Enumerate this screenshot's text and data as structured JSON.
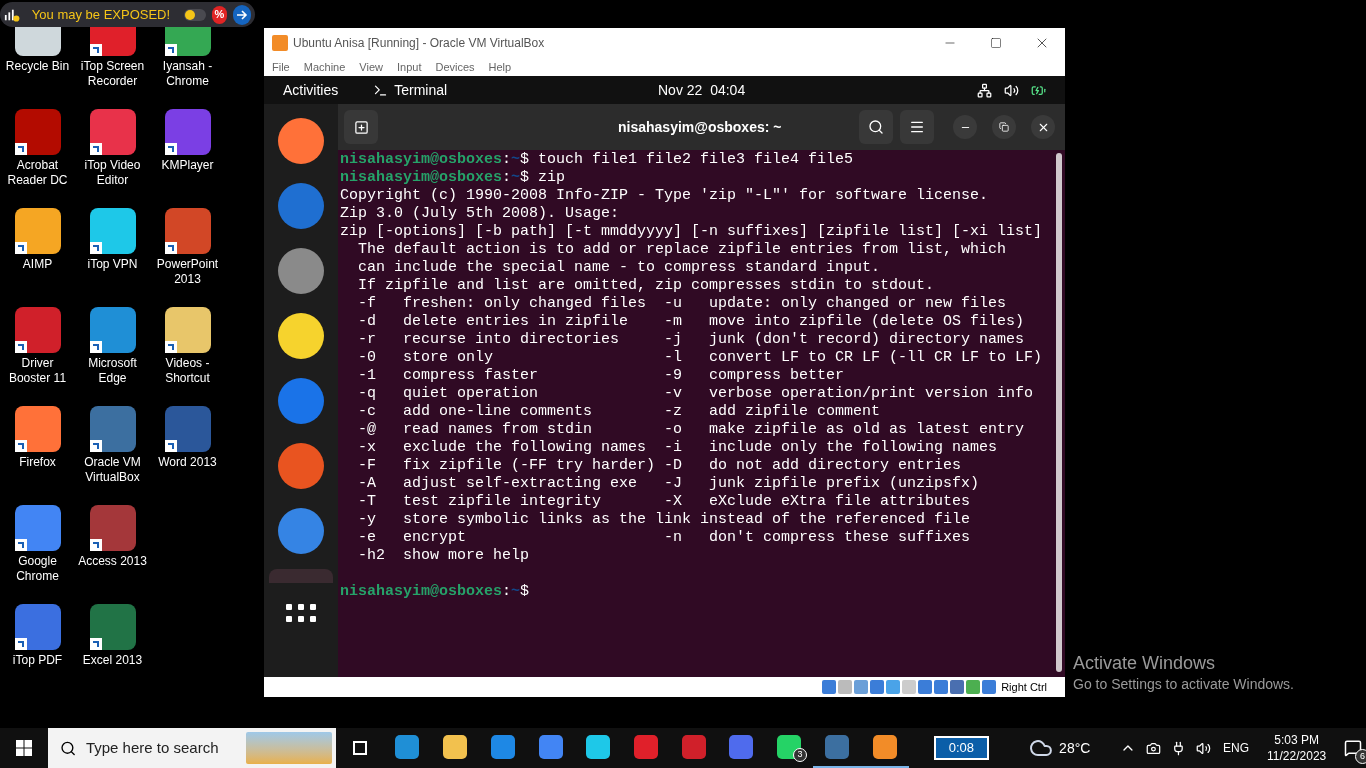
{
  "banner": {
    "text": "You may be EXPOSED!",
    "toggle_on": false,
    "badge": "%"
  },
  "desktop_icons": [
    {
      "label": "Recycle Bin",
      "color": "#cfd8dc",
      "shortcut": false
    },
    {
      "label": "Acrobat Reader DC",
      "color": "#b30b00",
      "shortcut": true
    },
    {
      "label": "AIMP",
      "color": "#f5a623",
      "shortcut": true
    },
    {
      "label": "Driver Booster 11",
      "color": "#d0202a",
      "shortcut": true
    },
    {
      "label": "Firefox",
      "color": "#ff7139",
      "shortcut": true
    },
    {
      "label": "Google Chrome",
      "color": "#4285f4",
      "shortcut": true
    },
    {
      "label": "iTop PDF",
      "color": "#3b6fe0",
      "shortcut": true
    },
    {
      "label": "iTop Screen Recorder",
      "color": "#e0202a",
      "shortcut": true
    },
    {
      "label": "iTop Video Editor",
      "color": "#e8324a",
      "shortcut": true
    },
    {
      "label": "iTop VPN",
      "color": "#1ec8e8",
      "shortcut": true
    },
    {
      "label": "Microsoft Edge",
      "color": "#1f8fd6",
      "shortcut": true
    },
    {
      "label": "Oracle VM VirtualBox",
      "color": "#3c6fa0",
      "shortcut": true
    },
    {
      "label": "Access 2013",
      "color": "#a4373a",
      "shortcut": true
    },
    {
      "label": "Excel 2013",
      "color": "#217346",
      "shortcut": true
    },
    {
      "label": "Iyansah - Chrome",
      "color": "#34a853",
      "shortcut": true
    },
    {
      "label": "KMPlayer",
      "color": "#7b3fe4",
      "shortcut": true
    },
    {
      "label": "PowerPoint 2013",
      "color": "#d24726",
      "shortcut": true
    },
    {
      "label": "Videos - Shortcut",
      "color": "#e8c66a",
      "shortcut": true
    },
    {
      "label": "Word 2013",
      "color": "#2b579a",
      "shortcut": true
    }
  ],
  "vm_window": {
    "title": "Ubuntu Anisa [Running] - Oracle VM VirtualBox",
    "menu": [
      "File",
      "Machine",
      "View",
      "Input",
      "Devices",
      "Help"
    ],
    "status_key": "Right Ctrl"
  },
  "ubuntu": {
    "activities": "Activities",
    "app_name": "Terminal",
    "clock": "Nov 22  04:04"
  },
  "terminal": {
    "title": "nisahasyim@osboxes: ~",
    "lines": [
      {
        "kind": "prompt",
        "user": "nisahasyim@osboxes",
        "colon": ":",
        "path": "~",
        "command": "$ touch file1 file2 file3 file4 file5"
      },
      {
        "kind": "prompt",
        "user": "nisahasyim@osboxes",
        "colon": ":",
        "path": "~",
        "command": "$ zip"
      },
      {
        "kind": "output",
        "text": "Copyright (c) 1990-2008 Info-ZIP - Type 'zip \"-L\"' for software license."
      },
      {
        "kind": "output",
        "text": "Zip 3.0 (July 5th 2008). Usage:"
      },
      {
        "kind": "output",
        "text": "zip [-options] [-b path] [-t mmddyyyy] [-n suffixes] [zipfile list] [-xi list]"
      },
      {
        "kind": "output",
        "text": "  The default action is to add or replace zipfile entries from list, which"
      },
      {
        "kind": "output",
        "text": "  can include the special name - to compress standard input."
      },
      {
        "kind": "output",
        "text": "  If zipfile and list are omitted, zip compresses stdin to stdout."
      },
      {
        "kind": "output",
        "text": "  -f   freshen: only changed files  -u   update: only changed or new files"
      },
      {
        "kind": "output",
        "text": "  -d   delete entries in zipfile    -m   move into zipfile (delete OS files)"
      },
      {
        "kind": "output",
        "text": "  -r   recurse into directories     -j   junk (don't record) directory names"
      },
      {
        "kind": "output",
        "text": "  -0   store only                   -l   convert LF to CR LF (-ll CR LF to LF)"
      },
      {
        "kind": "output",
        "text": "  -1   compress faster              -9   compress better"
      },
      {
        "kind": "output",
        "text": "  -q   quiet operation              -v   verbose operation/print version info"
      },
      {
        "kind": "output",
        "text": "  -c   add one-line comments        -z   add zipfile comment"
      },
      {
        "kind": "output",
        "text": "  -@   read names from stdin        -o   make zipfile as old as latest entry"
      },
      {
        "kind": "output",
        "text": "  -x   exclude the following names  -i   include only the following names"
      },
      {
        "kind": "output",
        "text": "  -F   fix zipfile (-FF try harder) -D   do not add directory entries"
      },
      {
        "kind": "output",
        "text": "  -A   adjust self-extracting exe   -J   junk zipfile prefix (unzipsfx)"
      },
      {
        "kind": "output",
        "text": "  -T   test zipfile integrity       -X   eXclude eXtra file attributes"
      },
      {
        "kind": "output",
        "text": "  -y   store symbolic links as the link instead of the referenced file"
      },
      {
        "kind": "output",
        "text": "  -e   encrypt                      -n   don't compress these suffixes"
      },
      {
        "kind": "output",
        "text": "  -h2  show more help"
      },
      {
        "kind": "blank"
      },
      {
        "kind": "prompt",
        "user": "nisahasyim@osboxes",
        "colon": ":",
        "path": "~",
        "command": "$"
      }
    ]
  },
  "activation": {
    "title": "Activate Windows",
    "subtitle": "Go to Settings to activate Windows."
  },
  "taskbar": {
    "search_placeholder": "Type here to search",
    "apps": [
      {
        "color": "#1f8fd6",
        "running": false
      },
      {
        "color": "#f2c14e",
        "running": false
      },
      {
        "color": "#1e88e5",
        "running": false
      },
      {
        "color": "#4285f4",
        "running": false
      },
      {
        "color": "#1ec8e8",
        "running": false
      },
      {
        "color": "#e0202a",
        "running": false
      },
      {
        "color": "#d0202a",
        "running": false
      },
      {
        "color": "#4f6bed",
        "running": false
      },
      {
        "color": "#25d366",
        "running": false,
        "badge": "3"
      },
      {
        "color": "#3c6fa0",
        "running": true
      },
      {
        "color": "#f28c28",
        "running": true
      }
    ],
    "timer": "0:08",
    "temperature": "28°C",
    "language": "ENG",
    "time": "5:03 PM",
    "date": "11/22/2023",
    "notifications": "6"
  }
}
